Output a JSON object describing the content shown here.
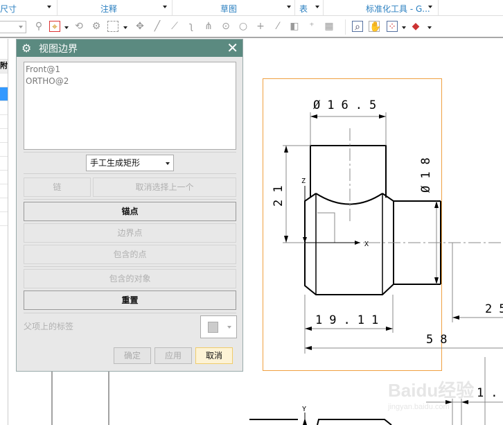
{
  "ribbon": {
    "groups": [
      "尺寸",
      "注释",
      "草图",
      "表",
      "标准化工具 - G..."
    ]
  },
  "toolbar": {
    "icons": [
      "snap-filter-icon",
      "point-filter-icon",
      "rotate-icon",
      "move-icon",
      "box-select-icon",
      "quad-icon",
      "line-icon",
      "segment-icon",
      "curve-icon",
      "arc-icon",
      "circle-center-icon",
      "circle-point-icon",
      "cross-icon",
      "diagonal-icon",
      "surface-icon",
      "add-point-icon",
      "grid-icon",
      "view-zoom-icon",
      "pan-icon",
      "layout-icon",
      "display-icon"
    ]
  },
  "left_panel": {
    "header": "附"
  },
  "dialog": {
    "title": "视图边界",
    "list_items": [
      "Front@1",
      "ORTHO@2"
    ],
    "boundary_type": "手工生成矩形",
    "chain_label": "链",
    "deselect_label": "取消选择上一个",
    "anchor_label": "锚点",
    "boundary_point_label": "边界点",
    "contained_points_label": "包含的点",
    "contained_objects_label": "包含的对象",
    "reset_label": "重置",
    "parent_label_text": "父项上的标签",
    "ok_label": "确定",
    "apply_label": "应用",
    "cancel_label": "取消"
  },
  "drawing": {
    "dim_diameter_top": "Ø16.5",
    "dim_height": "21",
    "dim_diameter_right": "Ø18",
    "dim_width": "19.11",
    "dim_total": "58",
    "dim_25": "25",
    "dim_small": "1.",
    "axis_x": "X",
    "axis_y": "Y",
    "axis_z": "Z",
    "boundary_color": "#f0a040"
  },
  "watermark": {
    "text": "Baidu经验",
    "url_text": "jingyan.baidu.com"
  }
}
